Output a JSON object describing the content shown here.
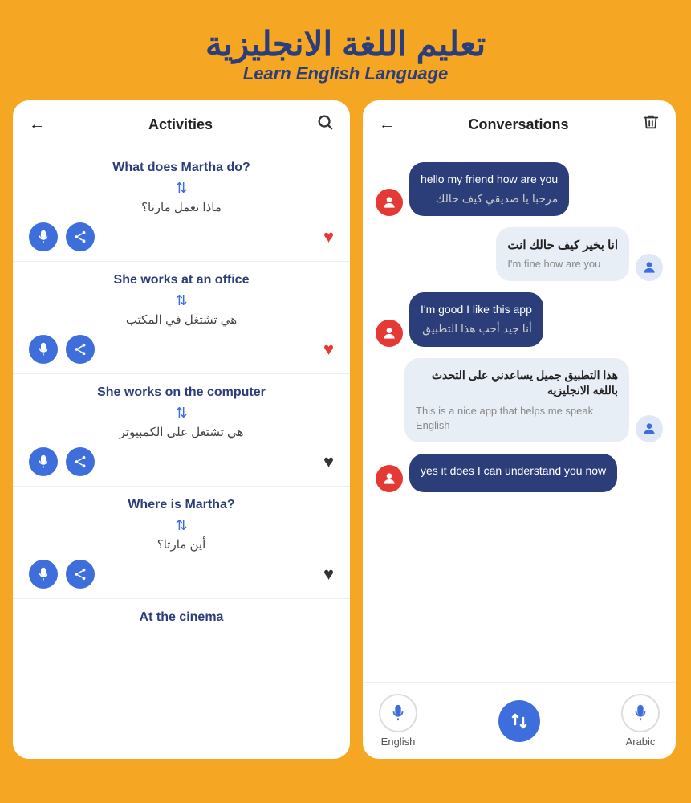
{
  "header": {
    "arabic_title": "تعليم اللغة الانجليزية",
    "english_title": "Learn English Language"
  },
  "left_panel": {
    "title": "Activities",
    "activities": [
      {
        "id": "activity-1",
        "english": "What does Martha do?",
        "arabic": "ماذا تعمل مارتا؟",
        "liked": true
      },
      {
        "id": "activity-2",
        "english": "She works at an office",
        "arabic": "هي تشتغل في المكتب",
        "liked": true
      },
      {
        "id": "activity-3",
        "english": "She works on the computer",
        "arabic": "هي تشتغل على الكمبيوتر",
        "liked": false
      },
      {
        "id": "activity-4",
        "english": "Where is Martha?",
        "arabic": "أين مارتا؟",
        "liked": false
      },
      {
        "id": "activity-5",
        "english": "At the cinema",
        "arabic": "",
        "liked": false
      }
    ]
  },
  "right_panel": {
    "title": "Conversations",
    "messages": [
      {
        "id": "msg-1",
        "side": "left",
        "avatar": "red",
        "text_main": "hello my friend how are you",
        "text_secondary": "مرحبا يا صديقي كيف حالك"
      },
      {
        "id": "msg-2",
        "side": "right",
        "avatar": "blue",
        "text_arabic": "انا بخير كيف حالك انت",
        "text_english": "I'm fine how are you"
      },
      {
        "id": "msg-3",
        "side": "left",
        "avatar": "red",
        "text_main": "I'm good I like this app",
        "text_secondary": "أنا جيد أحب هذا التطبيق"
      },
      {
        "id": "msg-4",
        "side": "right",
        "avatar": "blue",
        "text_arabic": "هذا التطبيق جميل يساعدني على التحدث باللغه الانجليزيه",
        "text_english": "This is a nice app that helps me speak English"
      },
      {
        "id": "msg-5",
        "side": "left",
        "avatar": "red",
        "text_main": "yes it does I can understand you now"
      }
    ],
    "bottom_bar": {
      "english_label": "English",
      "arabic_label": "Arabic"
    }
  }
}
